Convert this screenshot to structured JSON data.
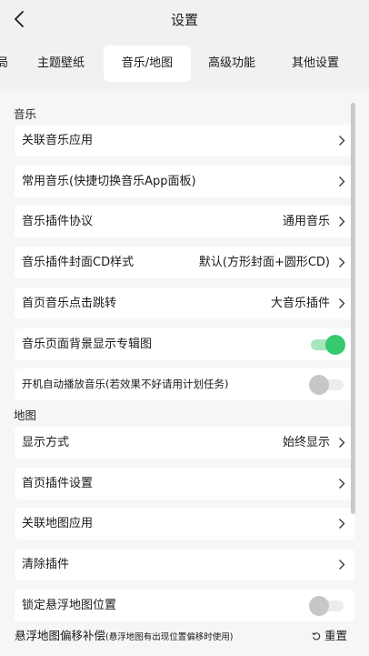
{
  "header": {
    "title": "设置"
  },
  "tabs": [
    {
      "label": "局"
    },
    {
      "label": "主题壁纸"
    },
    {
      "label": "音乐/地图"
    },
    {
      "label": "高级功能"
    },
    {
      "label": "其他设置"
    }
  ],
  "music": {
    "section_title": "音乐",
    "rows": [
      {
        "label": "关联音乐应用",
        "value": ""
      },
      {
        "label": "常用音乐(快捷切换音乐App面板)",
        "value": ""
      },
      {
        "label": "音乐插件协议",
        "value": "通用音乐"
      },
      {
        "label": "音乐插件封面CD样式",
        "value": "默认(方形封面+圆形CD)"
      },
      {
        "label": "首页音乐点击跳转",
        "value": "大音乐插件"
      }
    ],
    "toggles": [
      {
        "label": "音乐页面背景显示专辑图",
        "on": true
      },
      {
        "label": "开机自动播放音乐(若效果不好请用计划任务)",
        "on": false
      }
    ]
  },
  "map": {
    "section_title": "地图",
    "rows": [
      {
        "label": "显示方式",
        "value": "始终显示"
      },
      {
        "label": "首页插件设置",
        "value": ""
      },
      {
        "label": "关联地图应用",
        "value": ""
      },
      {
        "label": "清除插件",
        "value": ""
      }
    ],
    "toggles": [
      {
        "label": "锁定悬浮地图位置",
        "on": false
      }
    ],
    "offset": {
      "label": "悬浮地图偏移补偿",
      "hint": "(悬浮地图有出现位置偏移时使用)",
      "reset_label": "重置"
    }
  },
  "colors": {
    "toggle_on": "#36c96e",
    "toggle_off": "#c7c7c9",
    "background": "#f1f1f3"
  }
}
